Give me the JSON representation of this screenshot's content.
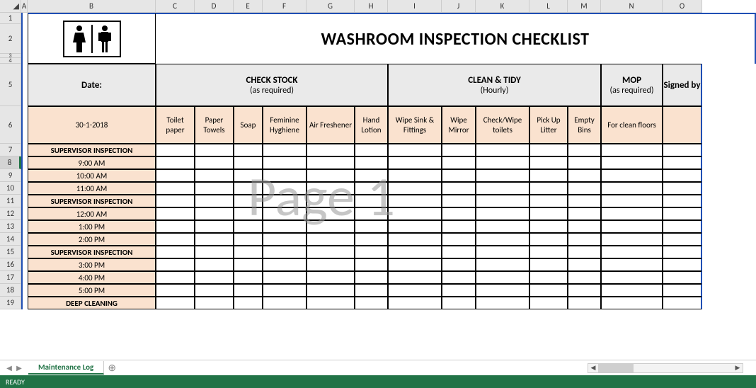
{
  "title": "WASHROOM INSPECTION CHECKLIST",
  "watermark": "Page 1",
  "columns": [
    "A",
    "B",
    "C",
    "D",
    "E",
    "F",
    "G",
    "H",
    "I",
    "J",
    "K",
    "L",
    "M",
    "N",
    "O"
  ],
  "row_numbers": [
    1,
    2,
    3,
    4,
    5,
    6,
    7,
    8,
    9,
    10,
    11,
    12,
    13,
    14,
    15,
    16,
    17,
    18,
    19
  ],
  "selected_row": 8,
  "headers": {
    "date_label": "Date:",
    "check_stock": "CHECK STOCK",
    "check_stock_sub": "(as required)",
    "clean_tidy": "CLEAN & TIDY",
    "clean_tidy_sub": "(Hourly)",
    "mop": "MOP",
    "mop_sub": "(as required)",
    "signed_by": "Signed by"
  },
  "date_value": "30-1-2018",
  "subheaders": {
    "toilet_paper": "Toilet paper",
    "paper_towels": "Paper Towels",
    "soap": "Soap",
    "feminine_hygiene": "Feminine Hyghiene",
    "air_freshener": "Air Freshener",
    "hand_lotion": "Hand Lotion",
    "wipe_sink": "Wipe Sink & Fittings",
    "wipe_mirror": "Wipe Mirror",
    "check_wipe_toilets": "Check/Wipe toilets",
    "pick_up_litter": "Pick Up Litter",
    "empty_bins": "Empty Bins",
    "for_clean_floors": "For clean floors"
  },
  "rows": [
    {
      "label": "SUPERVISOR INSPECTION",
      "type": "supervisor"
    },
    {
      "label": "9:00 AM",
      "type": "time"
    },
    {
      "label": "10:00 AM",
      "type": "time"
    },
    {
      "label": "11:00 AM",
      "type": "time"
    },
    {
      "label": "SUPERVISOR INSPECTION",
      "type": "supervisor"
    },
    {
      "label": "12:00 AM",
      "type": "time"
    },
    {
      "label": "1:00 PM",
      "type": "time"
    },
    {
      "label": "2:00 PM",
      "type": "time"
    },
    {
      "label": "SUPERVISOR INSPECTION",
      "type": "supervisor"
    },
    {
      "label": "3:00 PM",
      "type": "time"
    },
    {
      "label": "4:00 PM",
      "type": "time"
    },
    {
      "label": "5:00 PM",
      "type": "time"
    },
    {
      "label": "DEEP CLEANING",
      "type": "supervisor"
    }
  ],
  "tabs": {
    "active": "Maintenance Log"
  },
  "status": "READY"
}
